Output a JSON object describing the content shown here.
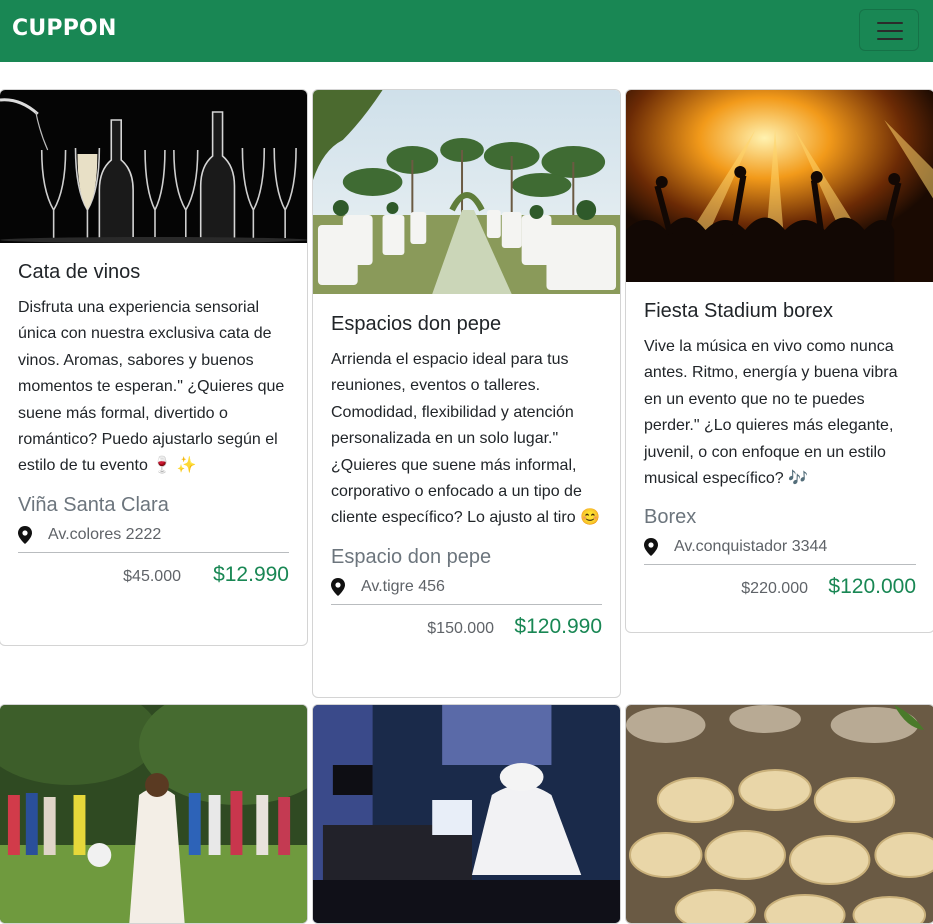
{
  "navbar": {
    "brand": "CUPPON",
    "menu_icon": "hamburger-menu-icon",
    "color": "#198754"
  },
  "cards": [
    {
      "title": "Cata de vinos",
      "description": "Disfruta una experiencia sensorial única con nuestra exclusiva cata de vinos. Aromas, sabores y buenos momentos te esperan.\" ¿Quieres que suene más formal, divertido o romántico? Puedo ajustarlo según el estilo de tu evento 🍷 ✨",
      "venue": "Viña Santa Clara",
      "address": "Av.colores 2222",
      "old_price": "$45.000",
      "price": "$12.990"
    },
    {
      "title": "Espacios don pepe",
      "description": "Arrienda el espacio ideal para tus reuniones, eventos o talleres. Comodidad, flexibilidad y atención personalizada en un solo lugar.\" ¿Quieres que suene más informal, corporativo o enfocado a un tipo de cliente específico? Lo ajusto al tiro 😊",
      "venue": "Espacio don pepe",
      "address": "Av.tigre 456",
      "old_price": "$150.000",
      "price": "$120.990"
    },
    {
      "title": "Fiesta Stadium borex",
      "description": "Vive la música en vivo como nunca antes. Ritmo, energía y buena vibra en un evento que no te puedes perder.\" ¿Lo quieres más elegante, juvenil, o con enfoque en un estilo musical específico? 🎶",
      "venue": "Borex",
      "address": "Av.conquistador 3344",
      "old_price": "$220.000",
      "price": "$120.000"
    }
  ],
  "colors": {
    "accent": "#198754",
    "muted": "#6c757d"
  },
  "icons": {
    "pin": "map-pin-icon"
  }
}
